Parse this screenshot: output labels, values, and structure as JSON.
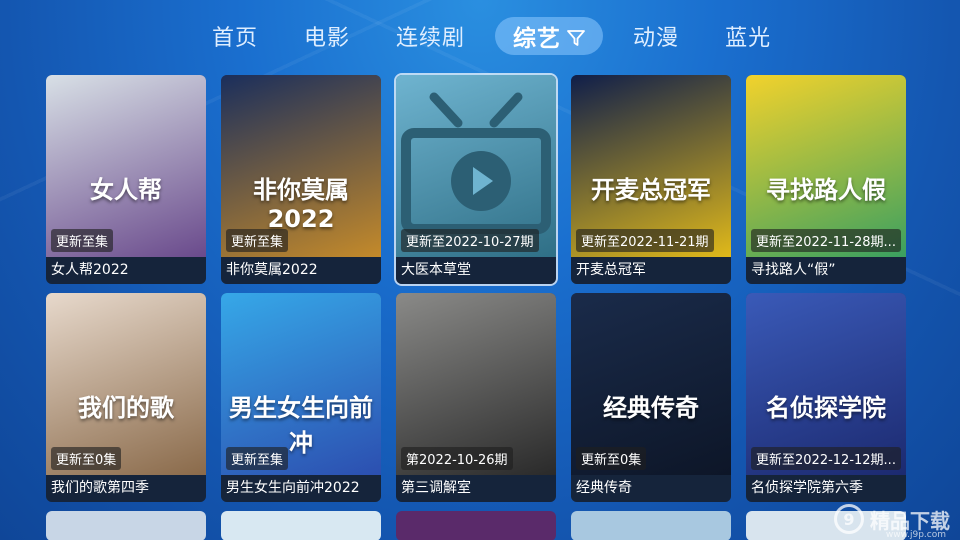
{
  "nav": {
    "tabs": [
      {
        "label": "首页",
        "active": false
      },
      {
        "label": "电影",
        "active": false
      },
      {
        "label": "连续剧",
        "active": false
      },
      {
        "label": "综艺",
        "active": true
      },
      {
        "label": "动漫",
        "active": false
      },
      {
        "label": "蓝光",
        "active": false
      }
    ],
    "filter_icon": "filter-icon"
  },
  "cards": [
    {
      "title": "女人帮2022",
      "badge": "更新至集",
      "poster_text": "女人帮",
      "colors": [
        "#d8e0e6",
        "#6a4a8c"
      ]
    },
    {
      "title": "非你莫属2022",
      "badge": "更新至集",
      "poster_text": "非你莫属 2022",
      "colors": [
        "#1a2e5c",
        "#c48a2a"
      ]
    },
    {
      "title": "大医本草堂",
      "badge": "更新至2022-10-27期",
      "poster_text": "",
      "colors": [
        "#6fb4d0",
        "#2f6f86"
      ]
    },
    {
      "title": "开麦总冠军",
      "badge": "更新至2022-11-21期",
      "poster_text": "开麦总冠军",
      "colors": [
        "#0f1e4a",
        "#e0b91a"
      ]
    },
    {
      "title": "寻找路人“假”",
      "badge": "更新至2022-11-28期...",
      "poster_text": "寻找路人假",
      "colors": [
        "#f2d22c",
        "#3aa060"
      ]
    },
    {
      "title": "我们的歌第四季",
      "badge": "更新至0集",
      "poster_text": "我们的歌",
      "colors": [
        "#e7d9cc",
        "#8a6a4a"
      ]
    },
    {
      "title": "男生女生向前冲2022",
      "badge": "更新至集",
      "poster_text": "男生女生向前冲",
      "colors": [
        "#36a8e8",
        "#2c4fb0"
      ]
    },
    {
      "title": "第三调解室",
      "badge": "第2022-10-26期",
      "poster_text": "",
      "colors": [
        "#8a8a88",
        "#2a2a2a"
      ]
    },
    {
      "title": "经典传奇",
      "badge": "更新至0集",
      "poster_text": "经典传奇",
      "colors": [
        "#1a2b4a",
        "#0d1628"
      ]
    },
    {
      "title": "名侦探学院第六季",
      "badge": "更新至2022-12-12期...",
      "poster_text": "名侦探学院",
      "colors": [
        "#3a5ab8",
        "#1c2a70"
      ]
    }
  ],
  "watermark": {
    "text": "精品下载",
    "sub": "www.j9p.com"
  }
}
